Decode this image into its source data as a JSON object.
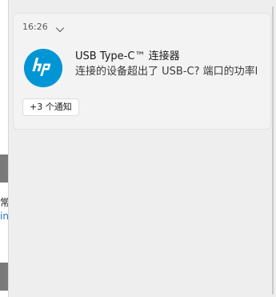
{
  "background_window": {
    "text_line_1": "常",
    "text_line_2": "in"
  },
  "notification": {
    "time": "16:26",
    "app_icon": "hp-logo-icon",
    "app_icon_color": "#0096d6",
    "title": "USB Type-C™ 连接器",
    "body": "连接的设备超出了 USB-C? 端口的功率l",
    "more_button_label": "+3 个通知"
  }
}
